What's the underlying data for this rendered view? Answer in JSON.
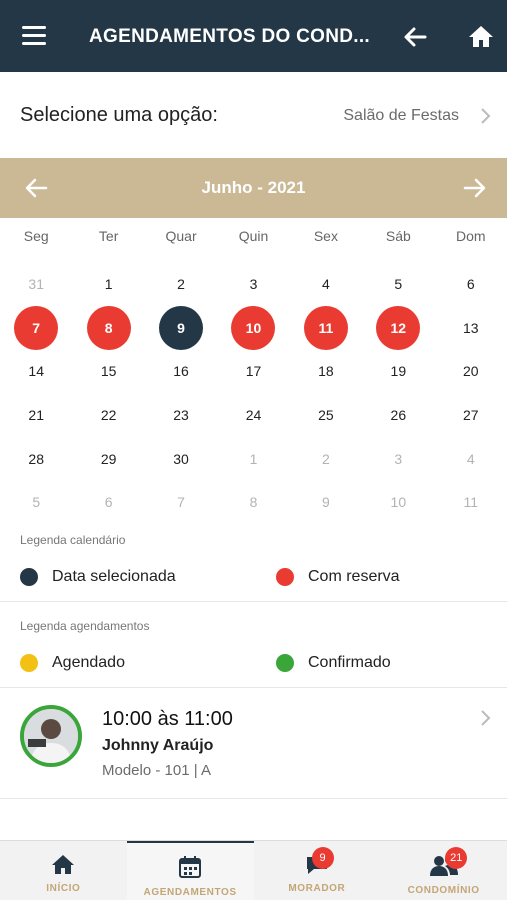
{
  "header": {
    "title": "AGENDAMENTOS DO COND...",
    "menu_icon": "menu-icon",
    "back_icon": "arrow-left-icon",
    "home_icon": "home-icon"
  },
  "selector": {
    "label": "Selecione uma opção:",
    "value": "Salão de Festas"
  },
  "calendar": {
    "month_label": "Junho - 2021",
    "weekdays": [
      "Seg",
      "Ter",
      "Quar",
      "Quin",
      "Sex",
      "Sáb",
      "Dom"
    ],
    "weeks": [
      [
        {
          "d": "31",
          "m": true
        },
        {
          "d": "1"
        },
        {
          "d": "2"
        },
        {
          "d": "3"
        },
        {
          "d": "4"
        },
        {
          "d": "5"
        },
        {
          "d": "6"
        }
      ],
      [
        {
          "d": "7",
          "s": "res"
        },
        {
          "d": "8",
          "s": "res"
        },
        {
          "d": "9",
          "s": "sel"
        },
        {
          "d": "10",
          "s": "res"
        },
        {
          "d": "11",
          "s": "res"
        },
        {
          "d": "12",
          "s": "res"
        },
        {
          "d": "13"
        }
      ],
      [
        {
          "d": "14"
        },
        {
          "d": "15"
        },
        {
          "d": "16"
        },
        {
          "d": "17"
        },
        {
          "d": "18"
        },
        {
          "d": "19"
        },
        {
          "d": "20"
        }
      ],
      [
        {
          "d": "21"
        },
        {
          "d": "22"
        },
        {
          "d": "23"
        },
        {
          "d": "24"
        },
        {
          "d": "25"
        },
        {
          "d": "26"
        },
        {
          "d": "27"
        }
      ],
      [
        {
          "d": "28"
        },
        {
          "d": "29"
        },
        {
          "d": "30"
        },
        {
          "d": "1",
          "m": true
        },
        {
          "d": "2",
          "m": true
        },
        {
          "d": "3",
          "m": true
        },
        {
          "d": "4",
          "m": true
        }
      ],
      [
        {
          "d": "5",
          "m": true
        },
        {
          "d": "6",
          "m": true
        },
        {
          "d": "7",
          "m": true
        },
        {
          "d": "8",
          "m": true
        },
        {
          "d": "9",
          "m": true
        },
        {
          "d": "10",
          "m": true
        },
        {
          "d": "11",
          "m": true
        }
      ]
    ]
  },
  "legend_calendar": {
    "title": "Legenda calendário",
    "selected": "Data selecionada",
    "reserved": "Com reserva"
  },
  "legend_appointments": {
    "title": "Legenda agendamentos",
    "scheduled": "Agendado",
    "confirmed": "Confirmado"
  },
  "colors": {
    "header": "#243746",
    "accent": "#cbb895",
    "reserved": "#ea3b32",
    "selected": "#243746",
    "scheduled": "#f2c114",
    "confirmed": "#3aa63a"
  },
  "appointment": {
    "time": "10:00 às 11:00",
    "name": "Johnny Araújo",
    "unit": "Modelo - 101 | A"
  },
  "nav": {
    "home": "INÍCIO",
    "schedules": "AGENDAMENTOS",
    "resident": "MORADOR",
    "resident_badge": "9",
    "condo": "CONDOMÍNIO",
    "condo_badge": "21"
  }
}
